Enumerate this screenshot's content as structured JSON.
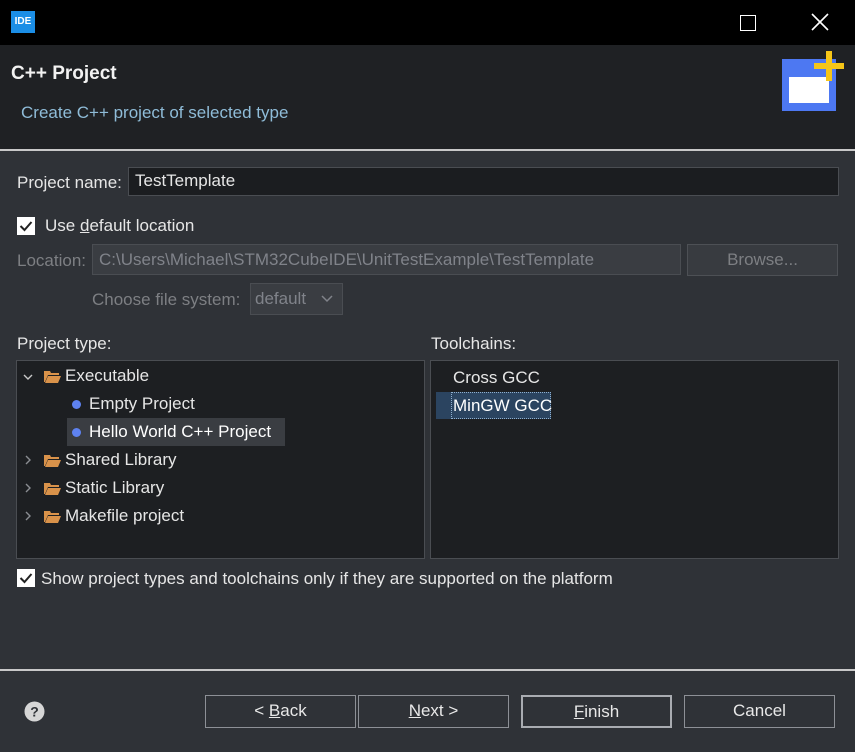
{
  "window": {
    "app_icon_text": "IDE",
    "title": ""
  },
  "header": {
    "title": "C++ Project",
    "description": "Create C++ project of selected type"
  },
  "form": {
    "project_name_label": "Project name:",
    "project_name_value": "TestTemplate",
    "use_default_location": {
      "checked": true,
      "pre": "Use ",
      "mnemonic": "d",
      "post": "efault location"
    },
    "location_label": "Location:",
    "location_value": "C:\\Users\\Michael\\STM32CubeIDE\\UnitTestExample\\TestTemplate",
    "browse_label": "Browse...",
    "file_system_label": "Choose file system:",
    "file_system_value": "default"
  },
  "project_type": {
    "label": "Project type:",
    "items": [
      {
        "label": "Executable",
        "expanded": true
      },
      {
        "label": "Empty Project"
      },
      {
        "label": "Hello World C++ Project",
        "selected": true
      },
      {
        "label": "Shared Library"
      },
      {
        "label": "Static Library"
      },
      {
        "label": "Makefile project"
      }
    ]
  },
  "toolchains": {
    "label": "Toolchains:",
    "items": [
      {
        "label": "Cross GCC"
      },
      {
        "label": "MinGW GCC",
        "selected": true
      }
    ]
  },
  "show_supported": {
    "checked": true,
    "label": "Show project types and toolchains only if they are supported on the platform"
  },
  "buttons": {
    "back": {
      "pre": "< ",
      "mnemonic": "B",
      "post": "ack"
    },
    "next": {
      "pre": "",
      "mnemonic": "N",
      "post": "ext >"
    },
    "finish": {
      "pre": "",
      "mnemonic": "F",
      "post": "inish"
    },
    "cancel": "Cancel"
  },
  "colors": {
    "accent": "#1b8ee6",
    "selection": "#2b4460",
    "banner_star": "#f5c518",
    "folder": "#d9924a",
    "dot": "#5e82f0"
  }
}
